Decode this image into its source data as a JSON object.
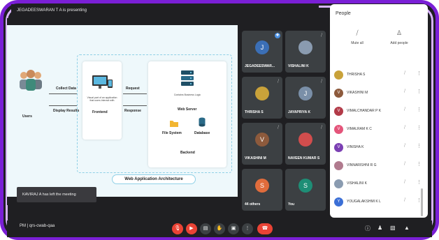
{
  "header": {
    "presenting_text": "JEGADEESWARAN T A is presenting"
  },
  "slide": {
    "users_label": "Users",
    "collect_data": "Collect Data",
    "display_results": "Display Results",
    "frontend_desc": "Visual part of an application that users interact with",
    "frontend_label": "Frontend",
    "request": "Request",
    "response": "Response",
    "backend_desc": "Contains Business Logic",
    "web_server": "Web Server",
    "file_system": "File System",
    "database": "Database",
    "backend_label": "Backend",
    "title": "Web Application Architecture"
  },
  "toast": {
    "text": "KAVIRAJ A has left the meeting"
  },
  "tiles": [
    {
      "initial": "J",
      "name": "JEGADEESWAR...",
      "color": "#3b6fb6"
    },
    {
      "initial": "",
      "name": "VISHALINI K",
      "color": "#8a9bb0"
    },
    {
      "initial": "",
      "name": "THRISHA S",
      "color": "#c9a23a"
    },
    {
      "initial": "J",
      "name": "JAYAPRIYA K",
      "color": "#7a8fa8"
    },
    {
      "initial": "V",
      "name": "VIKASHINI M",
      "color": "#8d5a3c"
    },
    {
      "initial": "",
      "name": "NAVEEN KUMAR S",
      "color": "#d14d4d"
    },
    {
      "initial": "S",
      "name": "44 others",
      "color": "#e06c3c"
    },
    {
      "initial": "S",
      "name": "You",
      "color": "#1e8e76"
    }
  ],
  "people": {
    "title": "People",
    "mute_all": "Mute all",
    "add_people": "Add people",
    "list": [
      {
        "name": "THRISHA S",
        "initial": "",
        "color": "#c9a23a"
      },
      {
        "name": "VIKASHINI M",
        "initial": "V",
        "color": "#8d5a3c"
      },
      {
        "name": "VIMALCHANDAR P K",
        "initial": "V",
        "color": "#b23a48"
      },
      {
        "name": "VIMALRAM K C",
        "initial": "V",
        "color": "#e4547a"
      },
      {
        "name": "VINISHA K",
        "initial": "V",
        "color": "#7b3fb3"
      },
      {
        "name": "VINNARISHNI R G",
        "initial": "",
        "color": "#b07a8e"
      },
      {
        "name": "VISHALINI K",
        "initial": "",
        "color": "#8a9bb0"
      },
      {
        "name": "YOUGALAKSHMI K L",
        "initial": "Y",
        "color": "#3b6fd6"
      }
    ]
  },
  "bottom": {
    "meeting_info": "PM  |  qrs-cwab-qaa"
  }
}
